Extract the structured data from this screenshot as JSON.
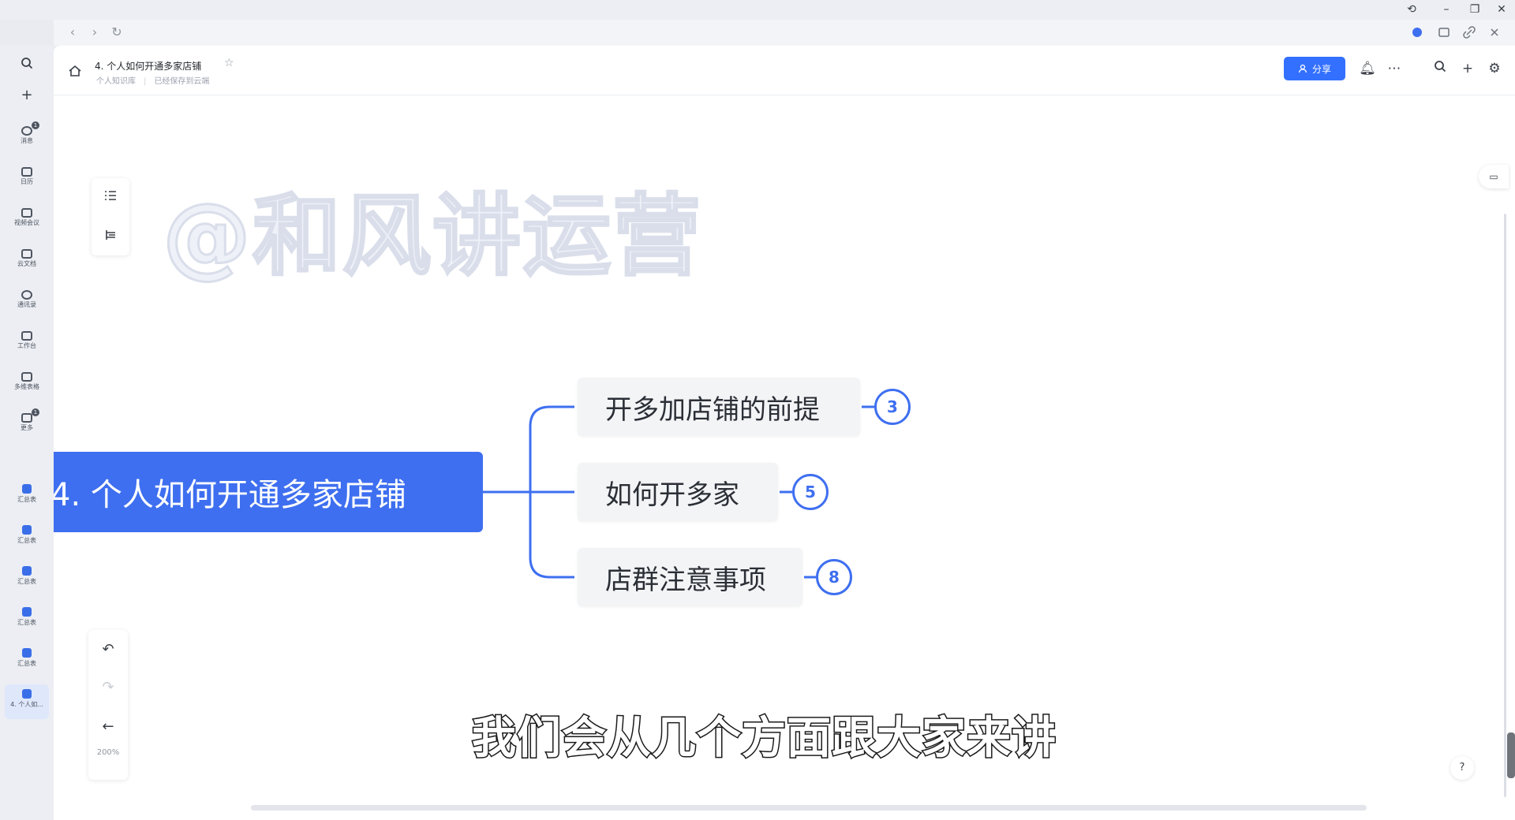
{
  "window": {
    "controls": [
      "history-icon",
      "minimize-icon",
      "maximize-icon",
      "close-icon"
    ]
  },
  "sidebar": {
    "top_icons": [
      "search-icon",
      "plus-icon"
    ],
    "items": [
      {
        "label": "消息",
        "icon": "chat-icon",
        "badge": "1"
      },
      {
        "label": "日历",
        "icon": "calendar-icon"
      },
      {
        "label": "视频会议",
        "icon": "video-icon"
      },
      {
        "label": "云文档",
        "icon": "doc-icon"
      },
      {
        "label": "通讯录",
        "icon": "contacts-icon"
      },
      {
        "label": "工作台",
        "icon": "apps-icon"
      },
      {
        "label": "多维表格",
        "icon": "table-icon"
      },
      {
        "label": "更多",
        "icon": "more-icon",
        "badge": "1"
      }
    ],
    "docs": [
      {
        "label": "汇总表",
        "icon": "mindmap-doc-icon"
      },
      {
        "label": "汇总表",
        "icon": "mindmap-doc-icon"
      },
      {
        "label": "汇总表",
        "icon": "mindmap-doc-icon"
      },
      {
        "label": "汇总表",
        "icon": "mindmap-doc-icon"
      },
      {
        "label": "汇总表",
        "icon": "mindmap-doc-icon"
      },
      {
        "label": "4. 个人如...",
        "icon": "mindmap-doc-icon",
        "active": true
      }
    ]
  },
  "header": {
    "title": "4. 个人如何开通多家店铺",
    "meta_owner": "个人知识库",
    "meta_status": "已经保存到云端",
    "share_label": "分享"
  },
  "watermark": "@和风讲运营",
  "mindmap": {
    "root": "4. 个人如何开通多家店铺",
    "children": [
      {
        "label": "开多加店铺的前提",
        "count": "3"
      },
      {
        "label": "如何开多家",
        "count": "5"
      },
      {
        "label": "店群注意事项",
        "count": "8"
      }
    ],
    "line_color": "#3e6ff0",
    "root_color": "#3e6ff0"
  },
  "tools": {
    "zoom": "200%"
  },
  "subtitle": "我们会从几个方面跟大家来讲",
  "colors": {
    "accent": "#3370ff",
    "background": "#e9ebf1"
  }
}
